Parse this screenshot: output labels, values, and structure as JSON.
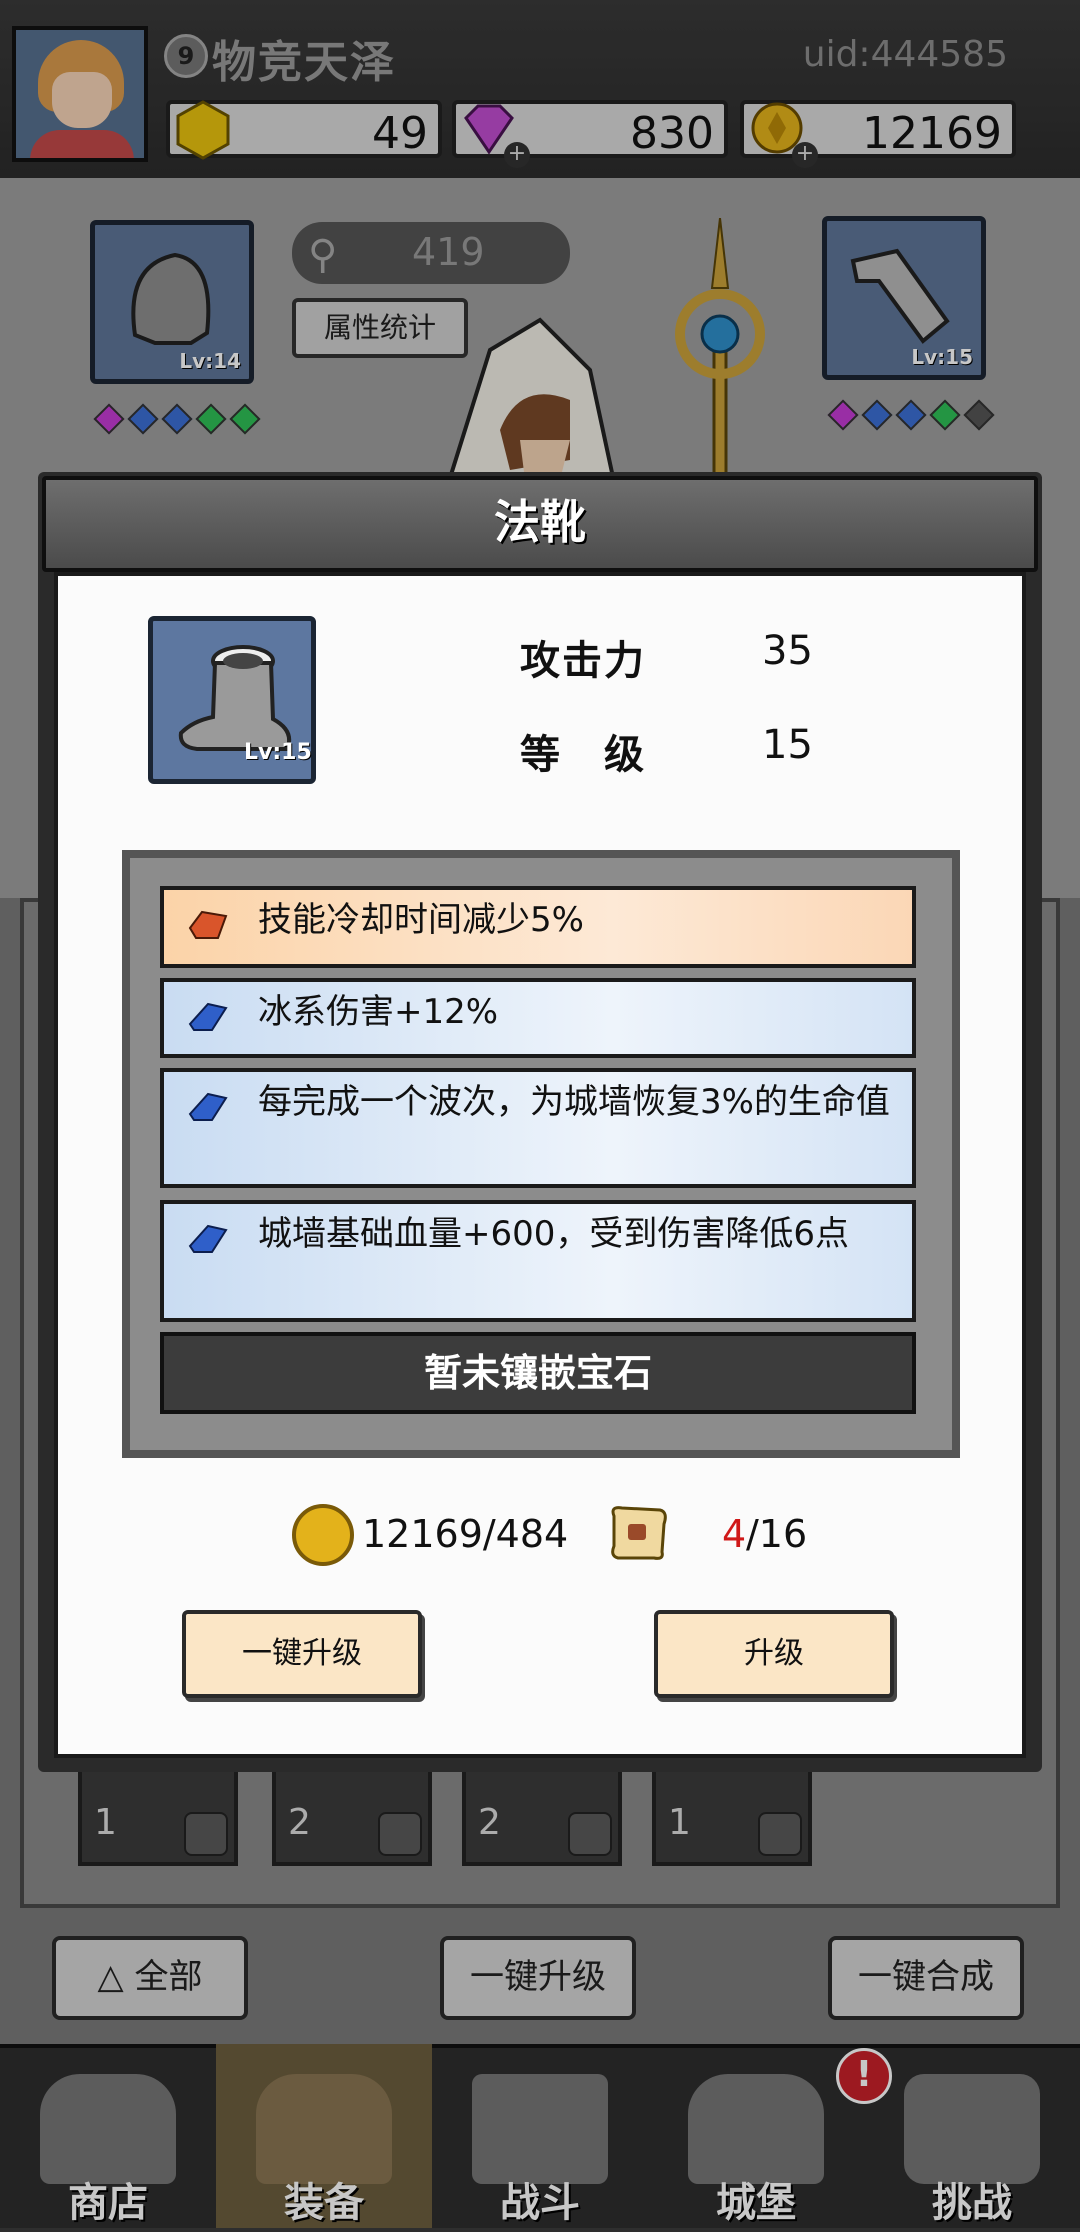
{
  "player": {
    "level": "9",
    "name": "物竞天泽",
    "uid": "uid:444585"
  },
  "resources": {
    "gold_bar": "49",
    "diamond": "830",
    "coin": "12169"
  },
  "equipment": {
    "power": "419",
    "stats_button": "属性统计",
    "slot_left_level": "Lv:14",
    "slot_right_level": "Lv:15"
  },
  "modal": {
    "title": "法靴",
    "item_level_badge": "Lv:15",
    "stats": [
      {
        "label": "攻击力",
        "value": "35"
      },
      {
        "label": "等　级",
        "value": "15"
      }
    ],
    "affixes": [
      {
        "text": "技能冷却时间减少5%",
        "rarity": "orange"
      },
      {
        "text": "冰系伤害+12%",
        "rarity": "blue"
      },
      {
        "text": "每完成一个波次，为城墙恢复3%的生命值",
        "rarity": "blue"
      },
      {
        "text": "城墙基础血量+600，受到伤害降低6点",
        "rarity": "blue"
      }
    ],
    "no_gem_text": "暂未镶嵌宝石",
    "coin_cost": "12169/484",
    "scroll_have": "4",
    "scroll_need": "/16",
    "upgrade_all_button": "一键升级",
    "upgrade_button": "升级"
  },
  "inventory": {
    "counts": [
      "1",
      "2",
      "2",
      "1"
    ]
  },
  "bottom_buttons": {
    "all_filter": "全部",
    "upgrade_all": "一键升级",
    "merge_all": "一键合成"
  },
  "nav": {
    "shop": "商店",
    "equip": "装备",
    "battle": "战斗",
    "castle": "城堡",
    "challenge": "挑战",
    "castle_alert": "!"
  },
  "colors": {
    "accent_red": "#d01919",
    "affix_orange": "#fbd3a8",
    "affix_blue": "#c9dcf2",
    "button_cream": "#fbe6c6"
  }
}
